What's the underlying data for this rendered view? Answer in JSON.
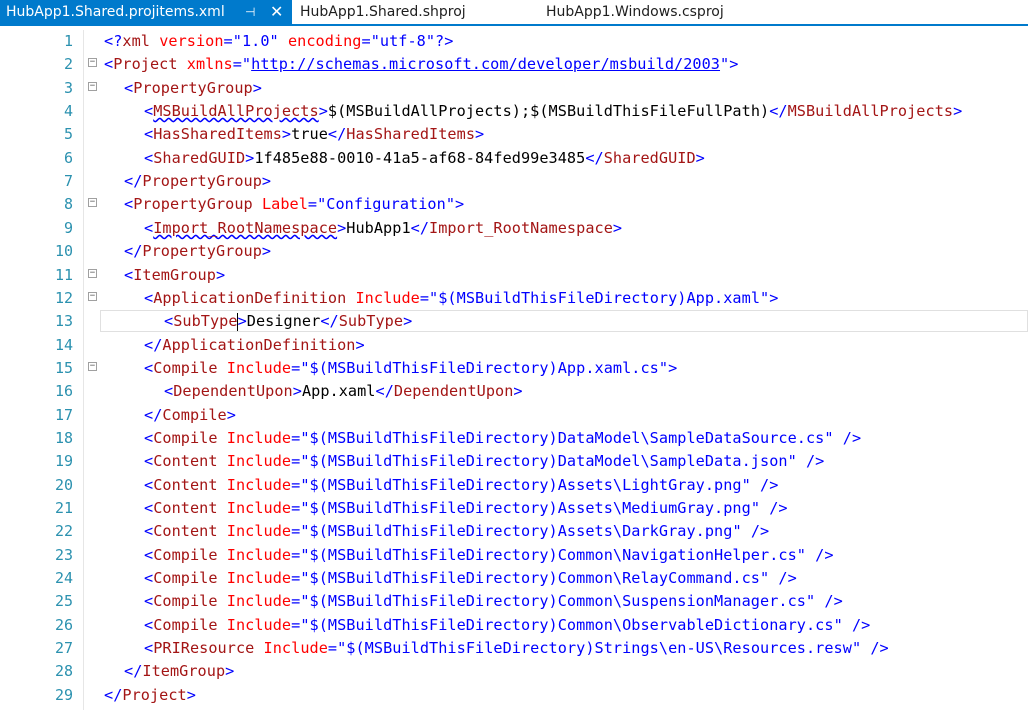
{
  "tabs": [
    {
      "label": "HubApp1.Shared.projitems.xml",
      "active": true,
      "pin_icon": "pin-icon",
      "close_icon": "close-icon"
    },
    {
      "label": "HubApp1.Shared.shproj",
      "active": false
    },
    {
      "label": "HubApp1.Windows.csproj",
      "active": false
    }
  ],
  "colors": {
    "accent": "#007acc",
    "line_number": "#2b91af",
    "bracket": "#0000ff",
    "element": "#a31515",
    "attribute": "#ff0000",
    "attr_value": "#0000ff"
  },
  "editor": {
    "current_line": 13,
    "lines": [
      {
        "n": "1",
        "fold": "",
        "indent": 0,
        "tokens": [
          {
            "t": "br",
            "v": "<?"
          },
          {
            "t": "el",
            "v": "xml"
          },
          {
            "t": "tx",
            "v": " "
          },
          {
            "t": "at",
            "v": "version"
          },
          {
            "t": "br",
            "v": "=\""
          },
          {
            "t": "av",
            "v": "1.0"
          },
          {
            "t": "br",
            "v": "\""
          },
          {
            "t": "tx",
            "v": " "
          },
          {
            "t": "at",
            "v": "encoding"
          },
          {
            "t": "br",
            "v": "=\""
          },
          {
            "t": "av",
            "v": "utf-8"
          },
          {
            "t": "br",
            "v": "\"?>"
          }
        ]
      },
      {
        "n": "2",
        "fold": "−",
        "indent": 0,
        "tokens": [
          {
            "t": "br",
            "v": "<"
          },
          {
            "t": "el",
            "v": "Project"
          },
          {
            "t": "tx",
            "v": " "
          },
          {
            "t": "at",
            "v": "xmlns"
          },
          {
            "t": "br",
            "v": "=\""
          },
          {
            "t": "av",
            "v": "http://schemas.microsoft.com/developer/msbuild/2003",
            "u": true
          },
          {
            "t": "br",
            "v": "\">"
          }
        ]
      },
      {
        "n": "3",
        "fold": "−",
        "indent": 2,
        "tokens": [
          {
            "t": "br",
            "v": "<"
          },
          {
            "t": "el",
            "v": "PropertyGroup"
          },
          {
            "t": "br",
            "v": ">"
          }
        ]
      },
      {
        "n": "4",
        "fold": "",
        "indent": 4,
        "tokens": [
          {
            "t": "br",
            "v": "<"
          },
          {
            "t": "el",
            "v": "MSBuildAllProjects",
            "sq": true
          },
          {
            "t": "br",
            "v": ">"
          },
          {
            "t": "tx",
            "v": "$(MSBuildAllProjects);$(MSBuildThisFileFullPath)"
          },
          {
            "t": "br",
            "v": "</"
          },
          {
            "t": "el",
            "v": "MSBuildAllProjects"
          },
          {
            "t": "br",
            "v": ">"
          }
        ]
      },
      {
        "n": "5",
        "fold": "",
        "indent": 4,
        "tokens": [
          {
            "t": "br",
            "v": "<"
          },
          {
            "t": "el",
            "v": "HasSharedItems"
          },
          {
            "t": "br",
            "v": ">"
          },
          {
            "t": "tx",
            "v": "true"
          },
          {
            "t": "br",
            "v": "</"
          },
          {
            "t": "el",
            "v": "HasSharedItems"
          },
          {
            "t": "br",
            "v": ">"
          }
        ]
      },
      {
        "n": "6",
        "fold": "",
        "indent": 4,
        "tokens": [
          {
            "t": "br",
            "v": "<"
          },
          {
            "t": "el",
            "v": "SharedGUID"
          },
          {
            "t": "br",
            "v": ">"
          },
          {
            "t": "tx",
            "v": "1f485e88-0010-41a5-af68-84fed99e3485"
          },
          {
            "t": "br",
            "v": "</"
          },
          {
            "t": "el",
            "v": "SharedGUID"
          },
          {
            "t": "br",
            "v": ">"
          }
        ]
      },
      {
        "n": "7",
        "fold": "",
        "indent": 2,
        "tokens": [
          {
            "t": "br",
            "v": "</"
          },
          {
            "t": "el",
            "v": "PropertyGroup"
          },
          {
            "t": "br",
            "v": ">"
          }
        ]
      },
      {
        "n": "8",
        "fold": "−",
        "indent": 2,
        "tokens": [
          {
            "t": "br",
            "v": "<"
          },
          {
            "t": "el",
            "v": "PropertyGroup"
          },
          {
            "t": "tx",
            "v": " "
          },
          {
            "t": "at",
            "v": "Label"
          },
          {
            "t": "br",
            "v": "=\""
          },
          {
            "t": "av",
            "v": "Configuration"
          },
          {
            "t": "br",
            "v": "\">"
          }
        ]
      },
      {
        "n": "9",
        "fold": "",
        "indent": 4,
        "tokens": [
          {
            "t": "br",
            "v": "<"
          },
          {
            "t": "el",
            "v": "Import_RootNamespace",
            "sq": true
          },
          {
            "t": "br",
            "v": ">"
          },
          {
            "t": "tx",
            "v": "HubApp1"
          },
          {
            "t": "br",
            "v": "</"
          },
          {
            "t": "el",
            "v": "Import_RootNamespace"
          },
          {
            "t": "br",
            "v": ">"
          }
        ]
      },
      {
        "n": "10",
        "fold": "",
        "indent": 2,
        "tokens": [
          {
            "t": "br",
            "v": "</"
          },
          {
            "t": "el",
            "v": "PropertyGroup"
          },
          {
            "t": "br",
            "v": ">"
          }
        ]
      },
      {
        "n": "11",
        "fold": "−",
        "indent": 2,
        "tokens": [
          {
            "t": "br",
            "v": "<"
          },
          {
            "t": "el",
            "v": "ItemGroup"
          },
          {
            "t": "br",
            "v": ">"
          }
        ]
      },
      {
        "n": "12",
        "fold": "−",
        "indent": 4,
        "tokens": [
          {
            "t": "br",
            "v": "<"
          },
          {
            "t": "el",
            "v": "ApplicationDefinition"
          },
          {
            "t": "tx",
            "v": " "
          },
          {
            "t": "at",
            "v": "Include"
          },
          {
            "t": "br",
            "v": "=\""
          },
          {
            "t": "av",
            "v": "$(MSBuildThisFileDirectory)App.xaml"
          },
          {
            "t": "br",
            "v": "\">"
          }
        ]
      },
      {
        "n": "13",
        "fold": "",
        "indent": 6,
        "tokens": [
          {
            "t": "br",
            "v": "<"
          },
          {
            "t": "el",
            "v": "SubType"
          },
          {
            "t": "br",
            "v": ">"
          },
          {
            "t": "tx",
            "v": "Designer"
          },
          {
            "t": "br",
            "v": "</"
          },
          {
            "t": "el",
            "v": "SubType"
          },
          {
            "t": "br",
            "v": ">"
          }
        ]
      },
      {
        "n": "14",
        "fold": "",
        "indent": 4,
        "tokens": [
          {
            "t": "br",
            "v": "</"
          },
          {
            "t": "el",
            "v": "ApplicationDefinition"
          },
          {
            "t": "br",
            "v": ">"
          }
        ]
      },
      {
        "n": "15",
        "fold": "−",
        "indent": 4,
        "tokens": [
          {
            "t": "br",
            "v": "<"
          },
          {
            "t": "el",
            "v": "Compile"
          },
          {
            "t": "tx",
            "v": " "
          },
          {
            "t": "at",
            "v": "Include"
          },
          {
            "t": "br",
            "v": "=\""
          },
          {
            "t": "av",
            "v": "$(MSBuildThisFileDirectory)App.xaml.cs"
          },
          {
            "t": "br",
            "v": "\">"
          }
        ]
      },
      {
        "n": "16",
        "fold": "",
        "indent": 6,
        "tokens": [
          {
            "t": "br",
            "v": "<"
          },
          {
            "t": "el",
            "v": "DependentUpon"
          },
          {
            "t": "br",
            "v": ">"
          },
          {
            "t": "tx",
            "v": "App.xaml"
          },
          {
            "t": "br",
            "v": "</"
          },
          {
            "t": "el",
            "v": "DependentUpon"
          },
          {
            "t": "br",
            "v": ">"
          }
        ]
      },
      {
        "n": "17",
        "fold": "",
        "indent": 4,
        "tokens": [
          {
            "t": "br",
            "v": "</"
          },
          {
            "t": "el",
            "v": "Compile"
          },
          {
            "t": "br",
            "v": ">"
          }
        ]
      },
      {
        "n": "18",
        "fold": "",
        "indent": 4,
        "tokens": [
          {
            "t": "br",
            "v": "<"
          },
          {
            "t": "el",
            "v": "Compile"
          },
          {
            "t": "tx",
            "v": " "
          },
          {
            "t": "at",
            "v": "Include"
          },
          {
            "t": "br",
            "v": "=\""
          },
          {
            "t": "av",
            "v": "$(MSBuildThisFileDirectory)DataModel\\SampleDataSource.cs"
          },
          {
            "t": "br",
            "v": "\" />"
          }
        ]
      },
      {
        "n": "19",
        "fold": "",
        "indent": 4,
        "tokens": [
          {
            "t": "br",
            "v": "<"
          },
          {
            "t": "el",
            "v": "Content"
          },
          {
            "t": "tx",
            "v": " "
          },
          {
            "t": "at",
            "v": "Include"
          },
          {
            "t": "br",
            "v": "=\""
          },
          {
            "t": "av",
            "v": "$(MSBuildThisFileDirectory)DataModel\\SampleData.json"
          },
          {
            "t": "br",
            "v": "\" />"
          }
        ]
      },
      {
        "n": "20",
        "fold": "",
        "indent": 4,
        "tokens": [
          {
            "t": "br",
            "v": "<"
          },
          {
            "t": "el",
            "v": "Content"
          },
          {
            "t": "tx",
            "v": " "
          },
          {
            "t": "at",
            "v": "Include"
          },
          {
            "t": "br",
            "v": "=\""
          },
          {
            "t": "av",
            "v": "$(MSBuildThisFileDirectory)Assets\\LightGray.png"
          },
          {
            "t": "br",
            "v": "\" />"
          }
        ]
      },
      {
        "n": "21",
        "fold": "",
        "indent": 4,
        "tokens": [
          {
            "t": "br",
            "v": "<"
          },
          {
            "t": "el",
            "v": "Content"
          },
          {
            "t": "tx",
            "v": " "
          },
          {
            "t": "at",
            "v": "Include"
          },
          {
            "t": "br",
            "v": "=\""
          },
          {
            "t": "av",
            "v": "$(MSBuildThisFileDirectory)Assets\\MediumGray.png"
          },
          {
            "t": "br",
            "v": "\" />"
          }
        ]
      },
      {
        "n": "22",
        "fold": "",
        "indent": 4,
        "tokens": [
          {
            "t": "br",
            "v": "<"
          },
          {
            "t": "el",
            "v": "Content"
          },
          {
            "t": "tx",
            "v": " "
          },
          {
            "t": "at",
            "v": "Include"
          },
          {
            "t": "br",
            "v": "=\""
          },
          {
            "t": "av",
            "v": "$(MSBuildThisFileDirectory)Assets\\DarkGray.png"
          },
          {
            "t": "br",
            "v": "\" />"
          }
        ]
      },
      {
        "n": "23",
        "fold": "",
        "indent": 4,
        "tokens": [
          {
            "t": "br",
            "v": "<"
          },
          {
            "t": "el",
            "v": "Compile"
          },
          {
            "t": "tx",
            "v": " "
          },
          {
            "t": "at",
            "v": "Include"
          },
          {
            "t": "br",
            "v": "=\""
          },
          {
            "t": "av",
            "v": "$(MSBuildThisFileDirectory)Common\\NavigationHelper.cs"
          },
          {
            "t": "br",
            "v": "\" />"
          }
        ]
      },
      {
        "n": "24",
        "fold": "",
        "indent": 4,
        "tokens": [
          {
            "t": "br",
            "v": "<"
          },
          {
            "t": "el",
            "v": "Compile"
          },
          {
            "t": "tx",
            "v": " "
          },
          {
            "t": "at",
            "v": "Include"
          },
          {
            "t": "br",
            "v": "=\""
          },
          {
            "t": "av",
            "v": "$(MSBuildThisFileDirectory)Common\\RelayCommand.cs"
          },
          {
            "t": "br",
            "v": "\" />"
          }
        ]
      },
      {
        "n": "25",
        "fold": "",
        "indent": 4,
        "tokens": [
          {
            "t": "br",
            "v": "<"
          },
          {
            "t": "el",
            "v": "Compile"
          },
          {
            "t": "tx",
            "v": " "
          },
          {
            "t": "at",
            "v": "Include"
          },
          {
            "t": "br",
            "v": "=\""
          },
          {
            "t": "av",
            "v": "$(MSBuildThisFileDirectory)Common\\SuspensionManager.cs"
          },
          {
            "t": "br",
            "v": "\" />"
          }
        ]
      },
      {
        "n": "26",
        "fold": "",
        "indent": 4,
        "tokens": [
          {
            "t": "br",
            "v": "<"
          },
          {
            "t": "el",
            "v": "Compile"
          },
          {
            "t": "tx",
            "v": " "
          },
          {
            "t": "at",
            "v": "Include"
          },
          {
            "t": "br",
            "v": "=\""
          },
          {
            "t": "av",
            "v": "$(MSBuildThisFileDirectory)Common\\ObservableDictionary.cs"
          },
          {
            "t": "br",
            "v": "\" />"
          }
        ]
      },
      {
        "n": "27",
        "fold": "",
        "indent": 4,
        "tokens": [
          {
            "t": "br",
            "v": "<"
          },
          {
            "t": "el",
            "v": "PRIResource"
          },
          {
            "t": "tx",
            "v": " "
          },
          {
            "t": "at",
            "v": "Include"
          },
          {
            "t": "br",
            "v": "=\""
          },
          {
            "t": "av",
            "v": "$(MSBuildThisFileDirectory)Strings\\en-US\\Resources.resw"
          },
          {
            "t": "br",
            "v": "\" />"
          }
        ]
      },
      {
        "n": "28",
        "fold": "",
        "indent": 2,
        "tokens": [
          {
            "t": "br",
            "v": "</"
          },
          {
            "t": "el",
            "v": "ItemGroup"
          },
          {
            "t": "br",
            "v": ">"
          }
        ]
      },
      {
        "n": "29",
        "fold": "",
        "indent": 0,
        "tokens": [
          {
            "t": "br",
            "v": "</"
          },
          {
            "t": "el",
            "v": "Project"
          },
          {
            "t": "br",
            "v": ">"
          }
        ]
      }
    ]
  }
}
